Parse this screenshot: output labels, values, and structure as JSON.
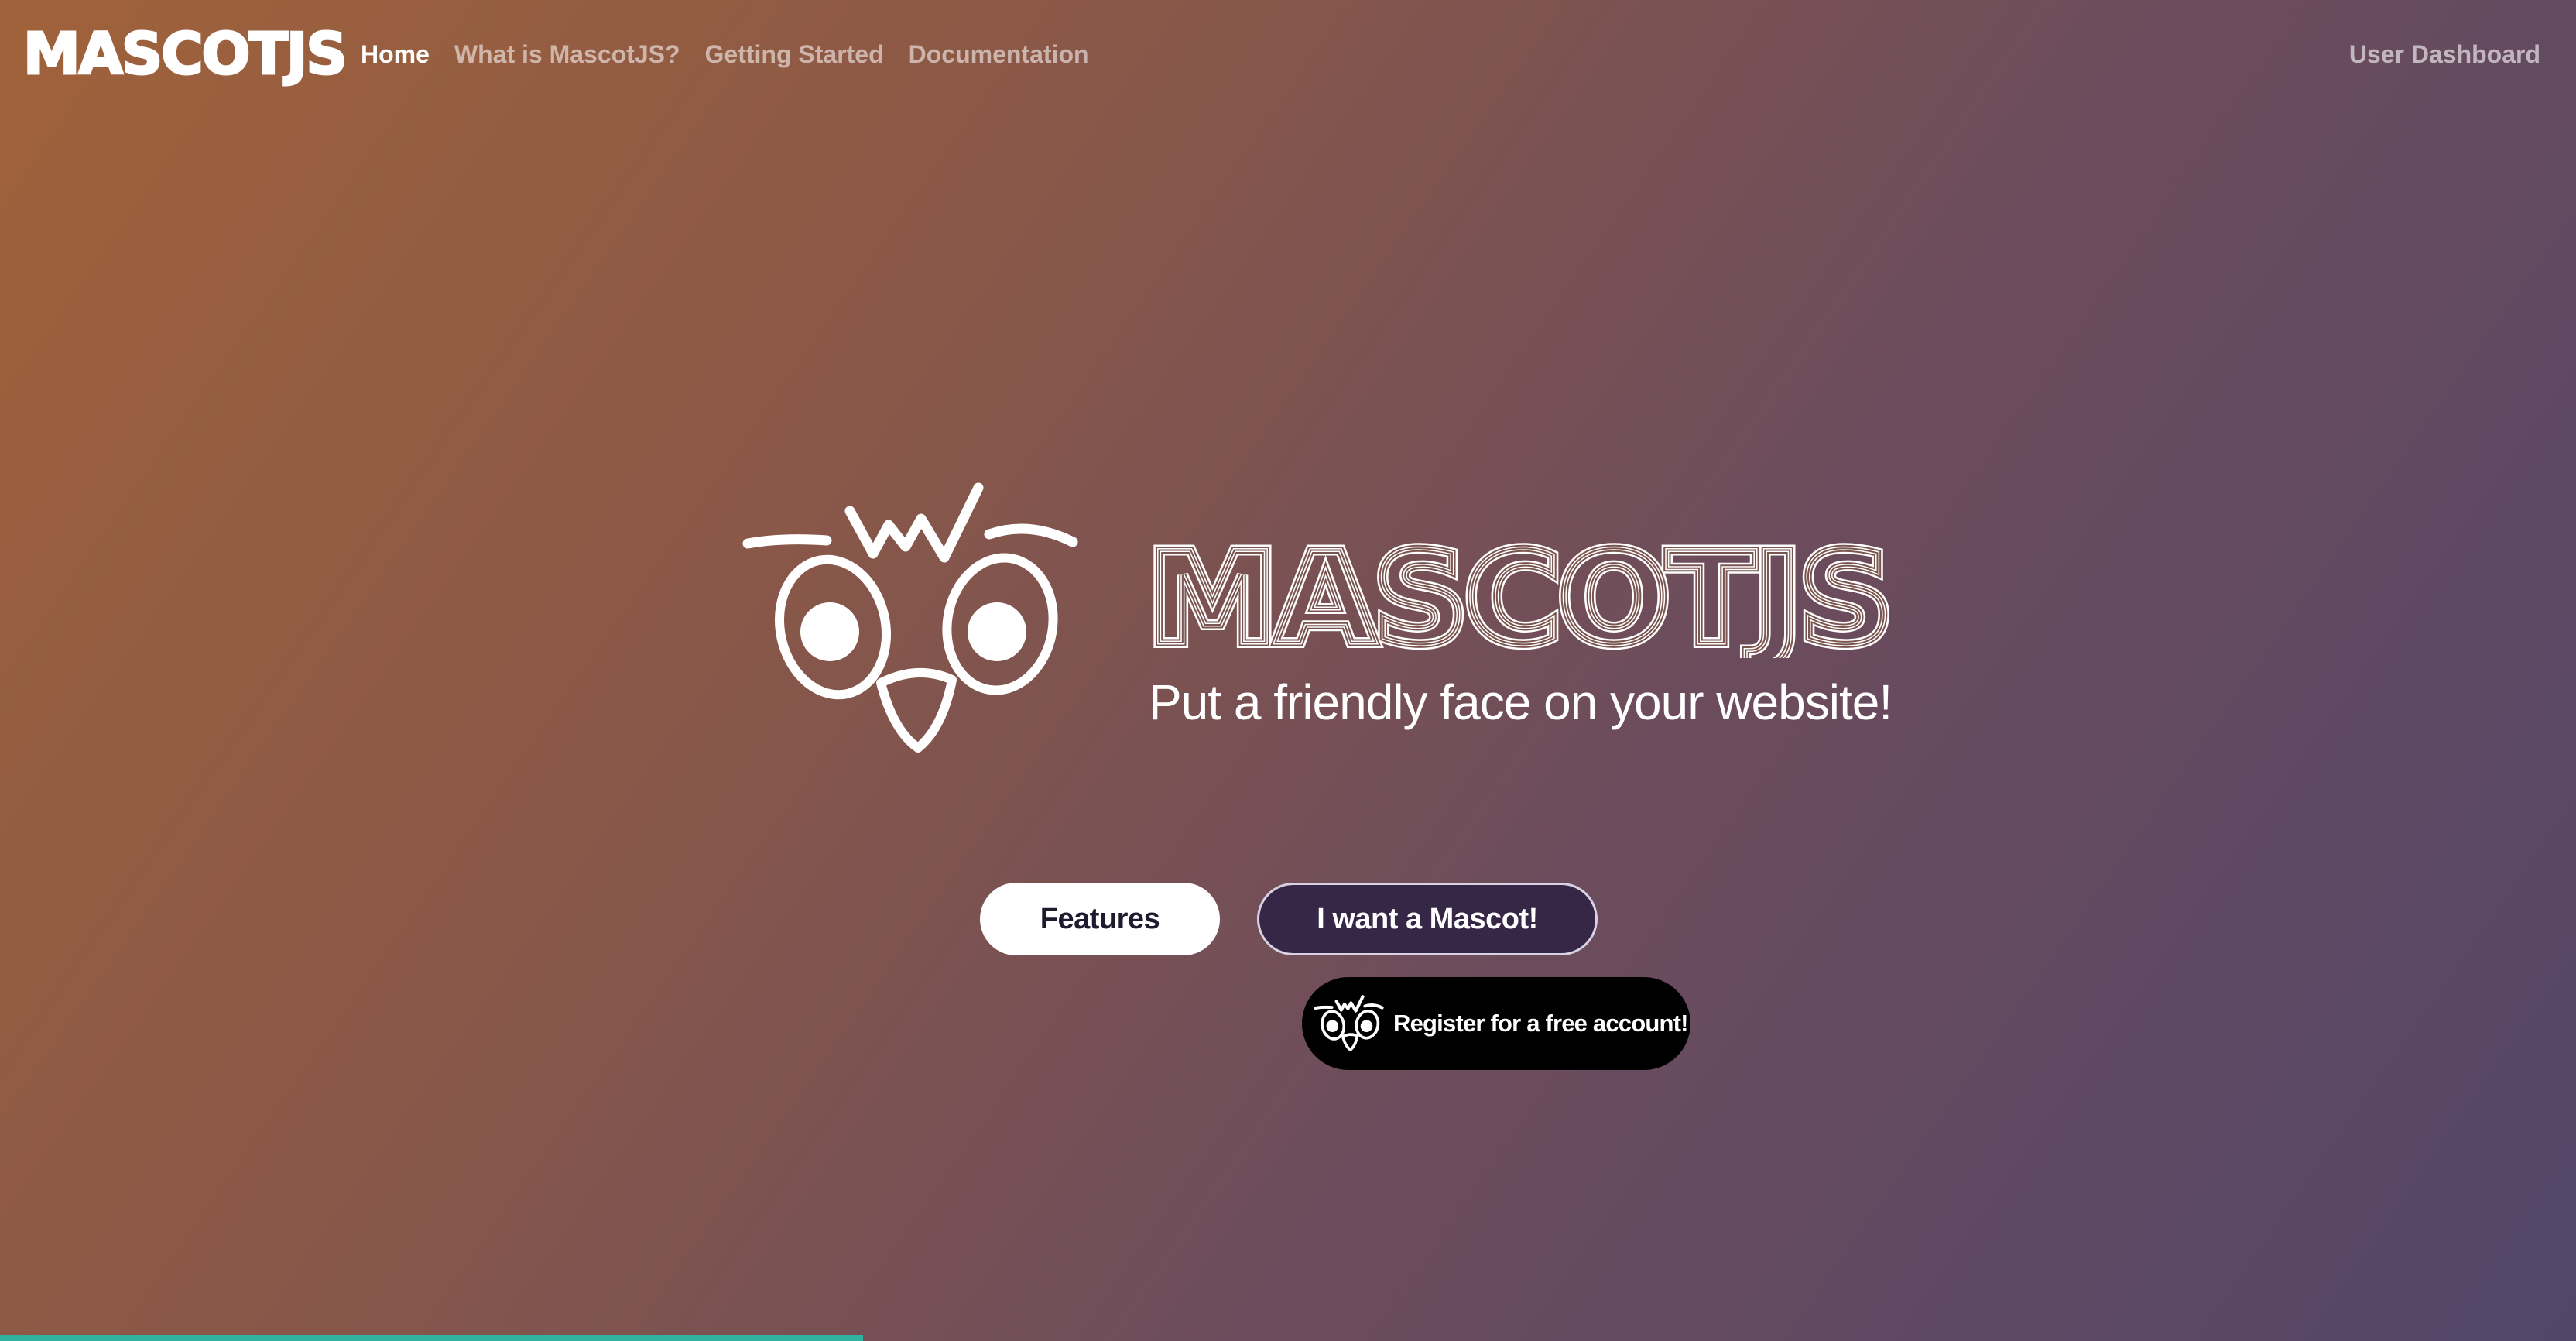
{
  "nav": {
    "brand": "MASCOTJS",
    "links": [
      {
        "label": "Home",
        "active": true
      },
      {
        "label": "What is MascotJS?",
        "active": false
      },
      {
        "label": "Getting Started",
        "active": false
      },
      {
        "label": "Documentation",
        "active": false
      }
    ],
    "right_link": "User Dashboard"
  },
  "hero": {
    "logo_text": "MASCOTJS",
    "tagline": "Put a friendly face on your website!",
    "mascot_icon": "owl-mascot-face-icon"
  },
  "buttons": {
    "features_label": "Features",
    "mascot_label": "I want a Mascot!",
    "register_label": "Register for a free account!"
  },
  "progress": {
    "value_fraction": 0.335,
    "color": "#2fb3a0"
  },
  "colors": {
    "gradient_start": "#a0623a",
    "gradient_end": "#524668",
    "mascot_button_bg": "#362747",
    "register_bg": "#000000"
  }
}
